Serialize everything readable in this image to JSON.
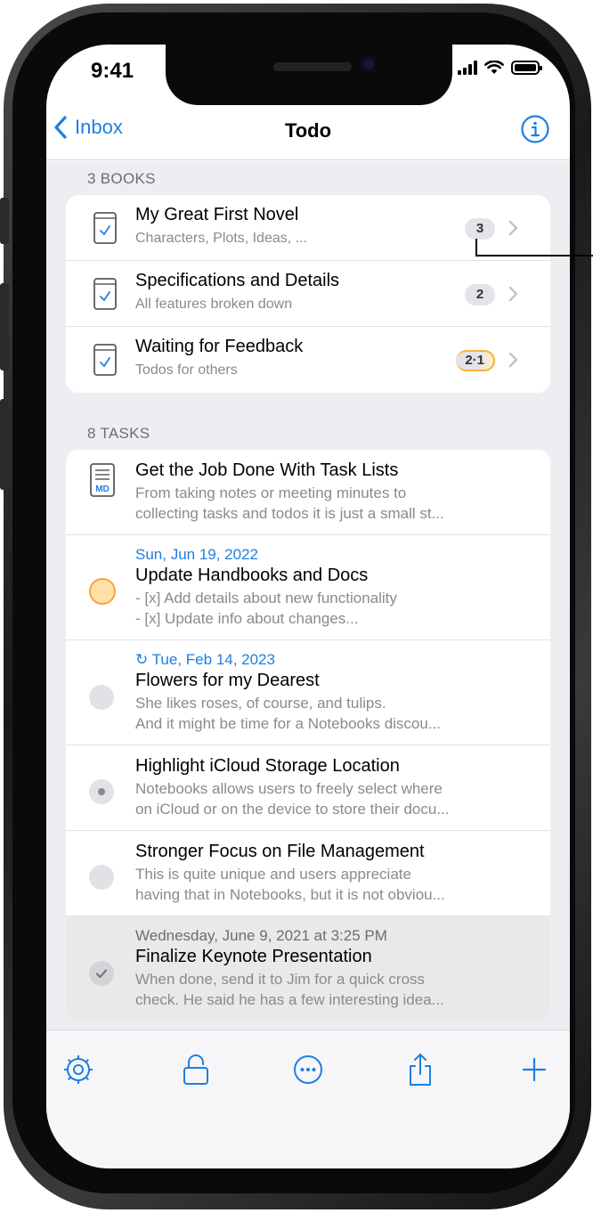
{
  "status": {
    "time": "9:41"
  },
  "nav": {
    "back_label": "Inbox",
    "title": "Todo"
  },
  "books": {
    "header": "3 BOOKS",
    "items": [
      {
        "title": "My Great First Novel",
        "subtitle": "Characters, Plots, Ideas, ...",
        "badge": "3"
      },
      {
        "title": "Specifications and Details",
        "subtitle": "All features broken down",
        "badge": "2"
      },
      {
        "title": "Waiting for Feedback",
        "subtitle": "Todos for others",
        "badge": "2·1"
      }
    ]
  },
  "tasks": {
    "header": "8 TASKS",
    "items": [
      {
        "date": "",
        "title": "Get the Job Done With Task Lists",
        "note1": "From taking notes or meeting minutes to",
        "note2": "collecting tasks and todos it is just a small st...",
        "icon": "md-document-icon"
      },
      {
        "date": "Sun, Jun 19, 2022",
        "title": "Update Handbooks and Docs",
        "note1": "- [x] Add details about new functionality",
        "note2": "- [x] Update info about changes...",
        "icon": "priority-circle-icon"
      },
      {
        "date": "↻ Tue, Feb 14, 2023",
        "title": "Flowers for my Dearest",
        "note1": "She likes roses, of course, and tulips.",
        "note2": "And it might be time for a Notebooks discou...",
        "icon": "empty-circle-icon"
      },
      {
        "date": "",
        "title": "Highlight iCloud Storage Location",
        "note1": "Notebooks allows users to freely select where",
        "note2": "on iCloud or on the device to store their docu...",
        "icon": "in-progress-circle-icon"
      },
      {
        "date": "",
        "title": "Stronger Focus on File Management",
        "note1": "This is quite unique and users appreciate",
        "note2": "having that in Notebooks, but it is not obviou...",
        "icon": "empty-circle-icon"
      },
      {
        "date": "Wednesday, June 9, 2021 at 3:25 PM",
        "title": "Finalize Keynote Presentation",
        "note1": "When done, send it to Jim for a quick cross",
        "note2": "check. He said he has a few interesting idea...",
        "icon": "checked-circle-icon"
      }
    ]
  },
  "toolbar": {
    "items": [
      "gear-icon",
      "lock-icon",
      "more-icon",
      "share-icon",
      "plus-icon"
    ]
  },
  "colors": {
    "accent": "#1e7fe0",
    "priority": "#f6a53a",
    "background": "#eeeef2"
  }
}
